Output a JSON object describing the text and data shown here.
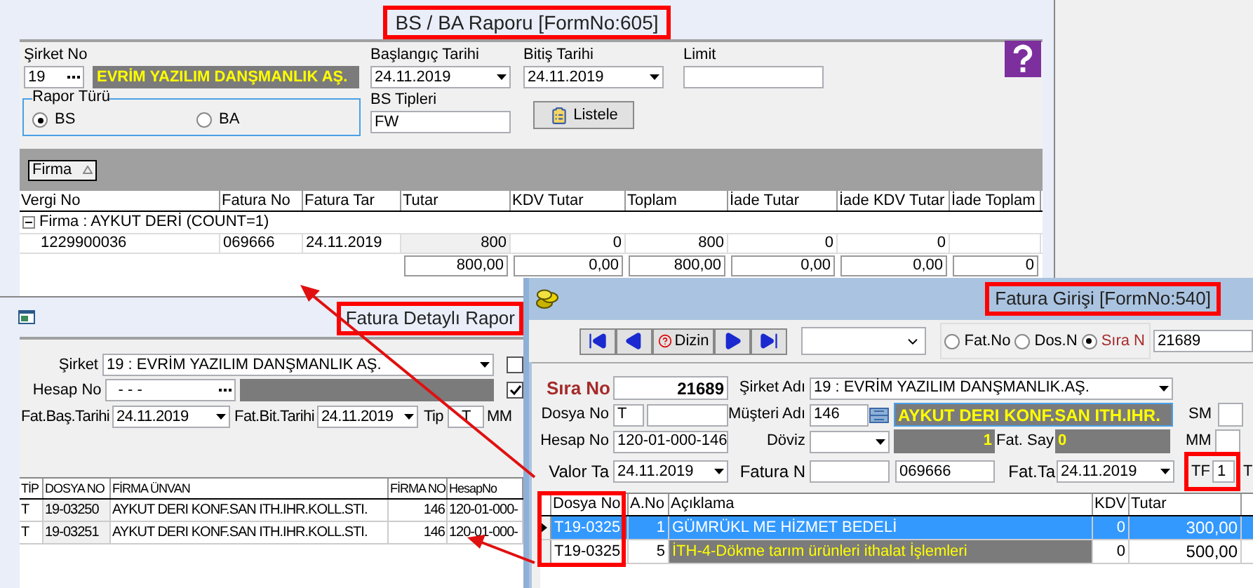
{
  "bs_ba_report": {
    "title": "BS / BA Raporu [FormNo:605]",
    "company": {
      "label": "Şirket No",
      "code": "19",
      "name": "EVRİM YAZILIM DANŞMANLIK AŞ."
    },
    "start_date": {
      "label": "Başlangıç Tarihi",
      "value": "24.11.2019"
    },
    "end_date": {
      "label": "Bitiş Tarihi",
      "value": "24.11.2019"
    },
    "limit": {
      "label": "Limit"
    },
    "report_type": {
      "label": "Rapor Türü",
      "options": [
        {
          "label": "BS",
          "selected": true
        },
        {
          "label": "BA",
          "selected": false
        }
      ]
    },
    "bs_types": {
      "label": "BS Tipleri",
      "value": "FW"
    },
    "list_button": "Listele",
    "group_by": "Firma",
    "table": {
      "columns": [
        "Vergi No",
        "Fatura No",
        "Fatura Tar",
        "Tutar",
        "KDV Tutar",
        "Toplam",
        "İade Tutar",
        "İade KDV Tutar",
        "İade Toplam"
      ],
      "groups": [
        {
          "label": "Firma : AYKUT DERİ (COUNT=1)",
          "expanded": true,
          "rows": [
            [
              "1229900036",
              "069666",
              "24.11.2019",
              "800",
              "0",
              "800",
              "0",
              "0"
            ]
          ]
        }
      ],
      "totals": [
        "800,00",
        "0,00",
        "800,00",
        "0,00",
        "0,00",
        "0"
      ]
    }
  },
  "invoice_detail_report": {
    "title": "Fatura Detaylı Rapor",
    "company": {
      "label": "Şirket",
      "value": "19 : EVRİM YAZILIM DANŞMANLIK AŞ."
    },
    "account": {
      "label": "Hesap No",
      "value": "- - -"
    },
    "start_date": {
      "label": "Fat.Baş.Tarihi",
      "value": "24.11.2019"
    },
    "end_date": {
      "label": "Fat.Bit.Tarihi",
      "value": "24.11.2019"
    },
    "type": {
      "label": "Tip",
      "value": "T"
    },
    "cut_label": "MM",
    "options": [
      {
        "checked": false
      },
      {
        "checked": true
      }
    ],
    "table": {
      "columns": [
        "TİP",
        "DOSYA NO",
        "FİRMA ÜNVAN",
        "FİRMA NO",
        "HesapNo"
      ],
      "rows": [
        [
          "T",
          "19-03250",
          "AYKUT DERI KONF.SAN ITH.IHR.KOLL.STI.",
          "146",
          "120-01-000-"
        ],
        [
          "T",
          "19-03251",
          "AYKUT DERI KONF.SAN ITH.IHR.KOLL.STI.",
          "146",
          "120-01-000-"
        ]
      ]
    }
  },
  "invoice_entry": {
    "title": "Fatura Girişi [FormNo:540]",
    "toolbar": {
      "index_button": "Dizin",
      "search_modes": [
        {
          "label": "Fat.No",
          "selected": false
        },
        {
          "label": "Dos.N",
          "selected": false
        },
        {
          "label": "Sıra N",
          "selected": true
        }
      ],
      "search_value": "21689"
    },
    "sequence": {
      "label": "Sıra No",
      "value": "21689"
    },
    "company": {
      "label": "Şirket Adı",
      "value": "19 : EVRİM YAZILIM DANŞMANLIK.AŞ."
    },
    "file_no": {
      "label": "Dosya No",
      "prefix": "T"
    },
    "customer": {
      "label": "Müşteri Adı",
      "code": "146",
      "name": "AYKUT DERI KONF.SAN ITH.IHR."
    },
    "sm": {
      "label": "SM"
    },
    "account": {
      "label": "Hesap No",
      "value": "120-01-000-146"
    },
    "currency": {
      "label": "Döviz"
    },
    "rate": "1",
    "invoice_count": {
      "label": "Fat. Say",
      "value": "0"
    },
    "mm": {
      "label": "MM"
    },
    "value_date": {
      "label": "Valor Ta",
      "value": "24.11.2019"
    },
    "invoice_no": {
      "label": "Fatura N",
      "value": "069666"
    },
    "invoice_date": {
      "label": "Fat.Ta",
      "value": "24.11.2019"
    },
    "tf": {
      "label": "TF",
      "value": "1"
    },
    "cut_label": "T",
    "lines": {
      "columns": [
        "Dosya No",
        "A.No",
        "Açıklama",
        "KDV",
        "Tutar"
      ],
      "rows": [
        {
          "cells": [
            "T19-0325",
            "1",
            "GÜMRÜKL ME HİZMET BEDELİ",
            "0",
            "300,00"
          ],
          "selected": true,
          "highlighted": false
        },
        {
          "cells": [
            "T19-0325",
            "5",
            "İTH-4-Dökme tarım ürünleri ithalat İşlemleri",
            "0",
            "500,00"
          ],
          "selected": false,
          "highlighted": true
        }
      ]
    }
  }
}
